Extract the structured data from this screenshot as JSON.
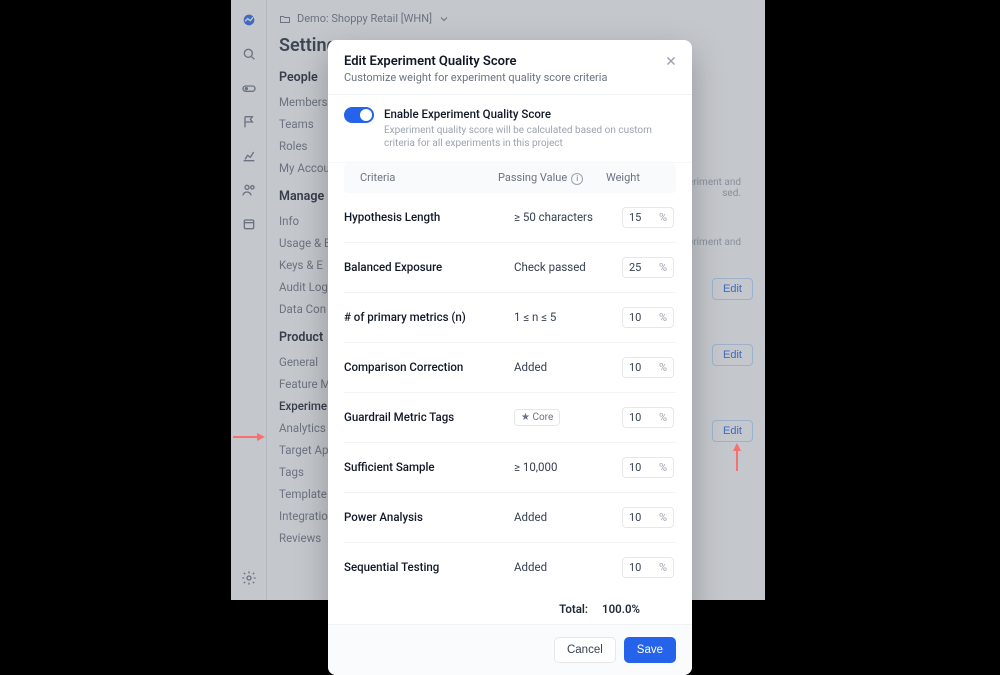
{
  "breadcrumb": {
    "project": "Demo: Shoppy Retail [WHN]"
  },
  "page_title": "Settings",
  "nav": {
    "sections": [
      {
        "title": "People",
        "items": [
          "Members",
          "Teams",
          "Roles",
          "My Account"
        ]
      },
      {
        "title": "Manage",
        "items": [
          "Info",
          "Usage & E",
          "Keys & E",
          "Audit Log",
          "Data Con"
        ]
      },
      {
        "title": "Product",
        "items": [
          "General",
          "Feature M",
          "Experime",
          "Analytics",
          "Target Ap",
          "Tags",
          "Template",
          "Integratio",
          "Reviews"
        ],
        "active_index": 2
      }
    ]
  },
  "bg_panel": {
    "snippets": [
      "xperiment and",
      "sed.",
      "experiment and"
    ],
    "edit_label": "Edit"
  },
  "modal": {
    "title": "Edit Experiment Quality Score",
    "subtitle": "Customize weight for experiment quality score criteria",
    "enable": {
      "label": "Enable Experiment Quality Score",
      "desc": "Experiment quality score will be calculated based on custom criteria for all experiments in this project"
    },
    "columns": {
      "criteria": "Criteria",
      "passing": "Passing Value",
      "weight": "Weight"
    },
    "rows": [
      {
        "name": "Hypothesis Length",
        "pass": "≥ 50 characters",
        "weight": "15"
      },
      {
        "name": "Balanced Exposure",
        "pass": "Check passed",
        "weight": "25"
      },
      {
        "name": "# of primary metrics (n)",
        "pass": "1 ≤  n ≤  5",
        "weight": "10"
      },
      {
        "name": "Comparison Correction",
        "pass": "Added",
        "weight": "10"
      },
      {
        "name": "Guardrail Metric Tags",
        "pass_tag": "Core",
        "weight": "10"
      },
      {
        "name": "Sufficient Sample",
        "pass": "≥ 10,000",
        "weight": "10"
      },
      {
        "name": "Power Analysis",
        "pass": "Added",
        "weight": "10"
      },
      {
        "name": "Sequential Testing",
        "pass": "Added",
        "weight": "10"
      }
    ],
    "total_label": "Total:",
    "total_value": "100.0%",
    "cancel": "Cancel",
    "save": "Save",
    "percent": "%"
  }
}
